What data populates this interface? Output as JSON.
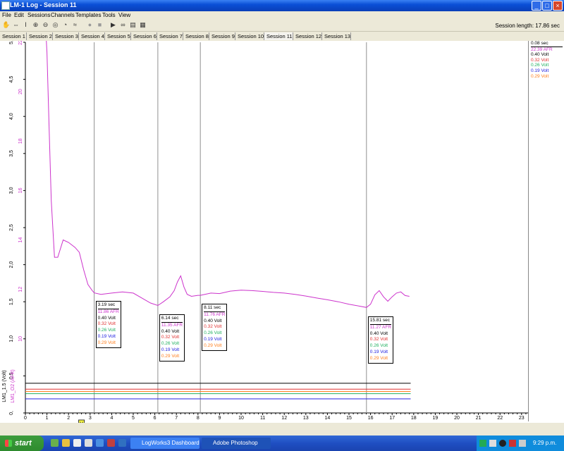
{
  "window": {
    "title": "LM-1 Log - Session 11",
    "minimize": "_",
    "maximize": "□",
    "close": "×"
  },
  "menu": [
    "File",
    "Edit",
    "Sessions",
    "Channels",
    "Templates",
    "Tools",
    "View"
  ],
  "toolbar": {
    "session_length": "Session length:  17.86 sec"
  },
  "tabs": [
    "Session 1",
    "Session 2",
    "Session 3",
    "Session 4",
    "Session 5",
    "Session 6",
    "Session 7",
    "Session 8",
    "Session 9",
    "Session 10",
    "Session 11",
    "Session 12",
    "Session 13"
  ],
  "active_tab": "Session 11",
  "legend": {
    "time": "0.08 sec",
    "rows": [
      {
        "text": "22.39 AFR",
        "color": "#cc33cc"
      },
      {
        "text": "0.40 Volt",
        "color": "#000000"
      },
      {
        "text": "0.32 Volt",
        "color": "#e03030"
      },
      {
        "text": "0.26 Volt",
        "color": "#20b060"
      },
      {
        "text": "0.19 Volt",
        "color": "#2020e0"
      },
      {
        "text": "0.29 Volt",
        "color": "#ff8020"
      }
    ]
  },
  "markers": [
    {
      "time": "3.19 sec",
      "rows": [
        "11.86 AFR",
        "0.40 Volt",
        "0.32 Volt",
        "0.26 Volt",
        "0.19 Volt",
        "0.29 Volt"
      ]
    },
    {
      "time": "6.14 sec",
      "rows": [
        "11.35 AFR",
        "0.40 Volt",
        "0.32 Volt",
        "0.26 Volt",
        "0.19 Volt",
        "0.29 Volt"
      ]
    },
    {
      "time": "8.11 sec",
      "rows": [
        "11.76 AFR",
        "0.40 Volt",
        "0.32 Volt",
        "0.26 Volt",
        "0.19 Volt",
        "0.29 Volt"
      ]
    },
    {
      "time": "15.81 sec",
      "rows": [
        "11.27 AFR",
        "0.40 Volt",
        "0.32 Volt",
        "0.26 Volt",
        "0.19 Volt",
        "0.29 Volt"
      ]
    }
  ],
  "series_colors": [
    "#cc33cc",
    "#000000",
    "#e03030",
    "#20b060",
    "#2020e0",
    "#ff8020"
  ],
  "chart_data": {
    "type": "line",
    "xlabel": "",
    "ylabel": "LM1_1.5 (Volt)",
    "ylabel2": "LM1_O2 (AFR)",
    "xlim": [
      0,
      23.3
    ],
    "ylim": [
      0,
      5
    ],
    "x_ticks": [
      "0",
      "1",
      "2",
      "3",
      "4",
      "5",
      "6",
      "7",
      "8",
      "9",
      "10",
      "11",
      "12",
      "13",
      "14",
      "15",
      "16",
      "17",
      "18",
      "19",
      "20",
      "21",
      "22",
      "23"
    ],
    "y_ticks_volt": [
      "0,",
      "0,5",
      "1,0",
      "1,5",
      "2,0",
      "2,5",
      "3,0",
      "3,5",
      "4,0",
      "4,5",
      "5,"
    ],
    "y_ticks_afr": [
      "10",
      "12",
      "14",
      "16",
      "18",
      "20",
      "22"
    ],
    "afr_axis": {
      "afr_at_bottom": 7,
      "afr_per_volt": 3
    },
    "markers_x": [
      3.19,
      6.14,
      8.11,
      15.81
    ],
    "series": [
      {
        "name": "LM1_O2 (AFR)",
        "axis": "afr",
        "x": [
          0,
          0.95,
          1.0,
          1.1,
          1.2,
          1.35,
          1.5,
          1.75,
          2.0,
          2.3,
          2.5,
          2.7,
          2.9,
          3.1,
          3.19,
          3.5,
          4.0,
          4.5,
          5.0,
          5.4,
          5.8,
          6.14,
          6.4,
          6.7,
          6.9,
          7.05,
          7.2,
          7.35,
          7.5,
          7.7,
          8.0,
          8.11,
          8.6,
          9.0,
          9.5,
          10.0,
          10.5,
          11.0,
          11.5,
          12.0,
          12.5,
          13.0,
          13.5,
          14.0,
          14.5,
          15.0,
          15.5,
          15.81,
          16.0,
          16.2,
          16.4,
          16.6,
          16.8,
          17.0,
          17.2,
          17.4,
          17.6,
          17.8
        ],
        "y": [
          22.39,
          22.39,
          21.6,
          18.5,
          15.6,
          13.3,
          13.3,
          14.0,
          13.9,
          13.7,
          13.5,
          12.8,
          12.2,
          11.95,
          11.86,
          11.8,
          11.85,
          11.9,
          11.85,
          11.65,
          11.45,
          11.35,
          11.5,
          11.7,
          11.95,
          12.3,
          12.55,
          12.1,
          11.8,
          11.72,
          11.76,
          11.76,
          11.85,
          11.83,
          11.93,
          11.97,
          11.95,
          11.92,
          11.88,
          11.85,
          11.8,
          11.73,
          11.65,
          11.58,
          11.5,
          11.4,
          11.32,
          11.27,
          11.4,
          11.78,
          11.95,
          11.7,
          11.52,
          11.7,
          11.85,
          11.9,
          11.75,
          11.72
        ]
      },
      {
        "name": "LM1_1.5 (Volt)",
        "axis": "volt",
        "x": [
          0,
          17.86
        ],
        "y": [
          0.4,
          0.4
        ]
      },
      {
        "name": "LM1_1.5 (Volt)",
        "axis": "volt",
        "x": [
          0,
          17.86
        ],
        "y": [
          0.32,
          0.32
        ]
      },
      {
        "name": "LM1_1.5 (Volt)",
        "axis": "volt",
        "x": [
          0,
          17.86
        ],
        "y": [
          0.26,
          0.26
        ]
      },
      {
        "name": "LM1_1.5 (Volt)",
        "axis": "volt",
        "x": [
          0,
          17.86
        ],
        "y": [
          0.19,
          0.19
        ]
      },
      {
        "name": "LM1_1.5 (Volt)",
        "axis": "volt",
        "x": [
          0,
          17.86
        ],
        "y": [
          0.29,
          0.29
        ]
      }
    ],
    "grid": false,
    "legend": "right"
  },
  "marker_flag": "M",
  "taskbar": {
    "start": "start",
    "tasks": [
      "LogWorks3 Dashboard",
      "Adobe Photoshop"
    ],
    "clock": "9:29 p.m."
  }
}
